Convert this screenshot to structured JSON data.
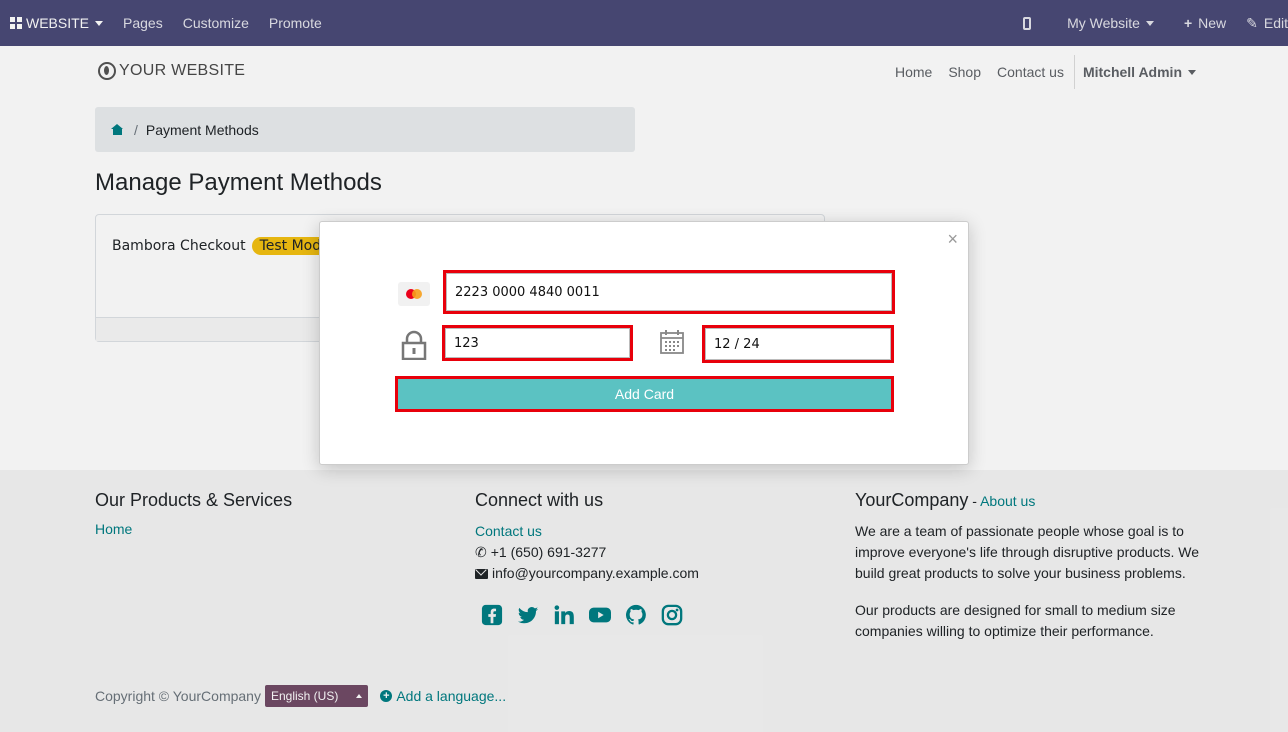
{
  "admin_bar": {
    "app_label": "WEBSITE",
    "menu": [
      "Pages",
      "Customize",
      "Promote"
    ],
    "website_switcher": "My Website",
    "new_label": "New",
    "edit_label": "Edit"
  },
  "site_header": {
    "logo_text": "YOUR WEBSITE",
    "nav": [
      "Home",
      "Shop",
      "Contact us"
    ],
    "user": "Mitchell Admin"
  },
  "breadcrumb": {
    "current": "Payment Methods",
    "separator": "/"
  },
  "page": {
    "title": "Manage Payment Methods",
    "provider_name": "Bambora Checkout",
    "provider_badge": "Test Mode"
  },
  "modal": {
    "close_symbol": "×",
    "card_number": "2223 0000 4840 0011",
    "cvc": "123",
    "expiry": "12 / 24",
    "submit_label": "Add Card",
    "highlight_color": "#e8000b",
    "button_color": "#5bc2c2"
  },
  "footer": {
    "col1": {
      "title": "Our Products & Services",
      "link": "Home"
    },
    "col2": {
      "title": "Connect with us",
      "contact_link": "Contact us",
      "phone": "+1 (650) 691-3277",
      "email": "info@yourcompany.example.com",
      "social_icons": [
        "facebook-icon",
        "twitter-icon",
        "linkedin-icon",
        "youtube-icon",
        "github-icon",
        "instagram-icon"
      ]
    },
    "col3": {
      "title": "YourCompany",
      "dash": " - ",
      "about_link": "About us",
      "para1": "We are a team of passionate people whose goal is to improve everyone's life through disruptive products. We build great products to solve your business problems.",
      "para2": "Our products are designed for small to medium size companies willing to optimize their performance."
    },
    "copyright": "Copyright © YourCompany",
    "language": "English (US)",
    "add_language": "Add a language..."
  },
  "colors": {
    "admin_bar": "#4a4a78",
    "link": "#017e84",
    "badge": "#f3c011"
  }
}
